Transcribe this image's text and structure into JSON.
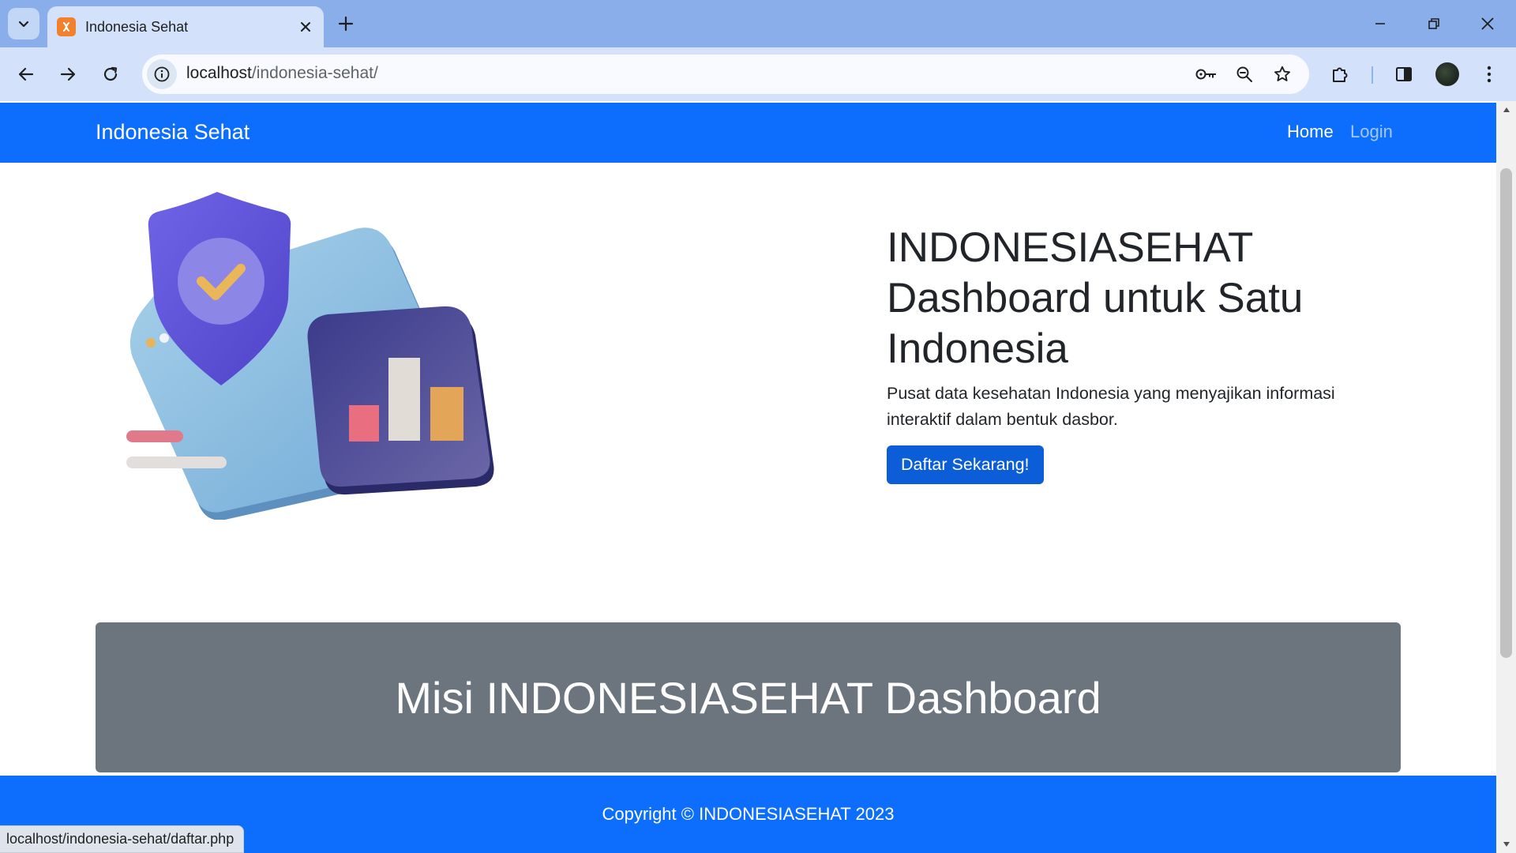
{
  "browser": {
    "tab_title": "Indonesia Sehat",
    "url_host": "localhost",
    "url_path": "/indonesia-sehat/",
    "status_url": "localhost/indonesia-sehat/daftar.php"
  },
  "site": {
    "brand": "Indonesia Sehat",
    "nav": {
      "home": "Home",
      "login": "Login"
    },
    "hero": {
      "title": "INDONESIASEHAT Dashboard untuk Satu Indonesia",
      "description": "Pusat data kesehatan Indonesia yang menyajikan informasi interaktif dalam bentuk dasbor.",
      "cta_label": "Daftar Sekarang!"
    },
    "mission_title": "Misi INDONESIASEHAT Dashboard",
    "footer": "Copyright © INDONESIASEHAT 2023"
  },
  "colors": {
    "primary": "#0d6efd",
    "button": "#0b5ed7",
    "mission_bg": "#6c757d",
    "browser_frame": "#8aaee9",
    "browser_toolbar": "#d3e2fa"
  },
  "icons": {
    "tab_search": "chevron-down-icon",
    "favicon": "xampp-icon",
    "tab_close": "close-icon",
    "new_tab": "plus-icon",
    "back": "arrow-left-icon",
    "forward": "arrow-right-icon",
    "reload": "reload-icon",
    "site_info": "info-icon",
    "password": "key-icon",
    "zoom": "zoom-icon",
    "bookmark": "star-icon",
    "extensions": "puzzle-icon",
    "side_panel": "side-panel-icon",
    "profile": "avatar",
    "menu": "kebab-menu-icon"
  }
}
